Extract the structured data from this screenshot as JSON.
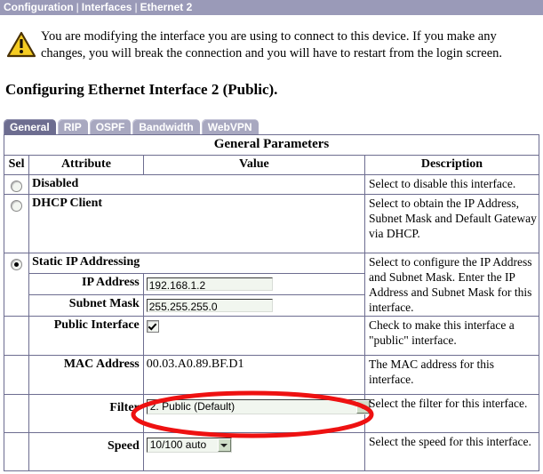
{
  "breadcrumb": {
    "items": [
      "Configuration",
      "Interfaces",
      "Ethernet 2"
    ],
    "separator": "|",
    "item0": "Configuration",
    "item1": "Interfaces",
    "item2": "Ethernet 2",
    "bar_color": "#9a9ab8",
    "text_color": "#ffffff"
  },
  "warning": {
    "icon": "warning-triangle-icon",
    "text": "You are modifying the interface you are using to connect to this device. If you make any changes, you will break the connection and you will have to restart from the login screen.",
    "icon_fill": "#f5cc22",
    "icon_stroke": "#5a3a08"
  },
  "page_title": "Configuring Ethernet Interface 2 (Public).",
  "tabs": {
    "active_index": 0,
    "items": [
      {
        "label": "General",
        "active": true
      },
      {
        "label": "RIP",
        "active": false
      },
      {
        "label": "OSPF",
        "active": false
      },
      {
        "label": "Bandwidth",
        "active": false
      },
      {
        "label": "WebVPN",
        "active": false
      }
    ],
    "tab0": "General",
    "tab1": "RIP",
    "tab2": "OSPF",
    "tab3": "Bandwidth",
    "tab4": "WebVPN",
    "active_color": "#6d6d90",
    "inactive_color": "#a8a8c0"
  },
  "table": {
    "caption": "General Parameters",
    "columns": {
      "sel": "Sel",
      "attribute": "Attribute",
      "value": "Value",
      "description": "Description"
    },
    "rows": {
      "disabled": {
        "attribute": "Disabled",
        "selected": false,
        "control": "radio",
        "description": "Select to disable this interface."
      },
      "dhcp_client": {
        "attribute": "DHCP Client",
        "selected": false,
        "control": "radio",
        "description": "Select to obtain the IP Address, Subnet Mask and Default Gateway via DHCP."
      },
      "static_ip": {
        "attribute": "Static IP Addressing",
        "selected": true,
        "control": "radio",
        "description": "Select to configure the IP Address and Subnet Mask. Enter the IP Address and Subnet Mask for this interface."
      },
      "ip_address": {
        "attribute": "IP Address",
        "value": "192.168.1.2",
        "placeholder": ""
      },
      "subnet_mask": {
        "attribute": "Subnet Mask",
        "value": "255.255.255.0",
        "placeholder": ""
      },
      "public_interface": {
        "attribute": "Public Interface",
        "checked": true,
        "description": "Check to make this interface a \"public\" interface."
      },
      "mac_address": {
        "attribute": "MAC Address",
        "value": "00.03.A0.89.BF.D1",
        "description": "The MAC address for this interface."
      },
      "filter": {
        "attribute": "Filter",
        "value": "2. Public (Default)",
        "description": "Select the filter for this interface."
      },
      "speed": {
        "attribute": "Speed",
        "value": "10/100 auto",
        "description": "Select the speed for this interface."
      }
    }
  },
  "annotation": {
    "shape": "ellipse",
    "color": "#ee1111",
    "target": "filter-dropdown"
  }
}
